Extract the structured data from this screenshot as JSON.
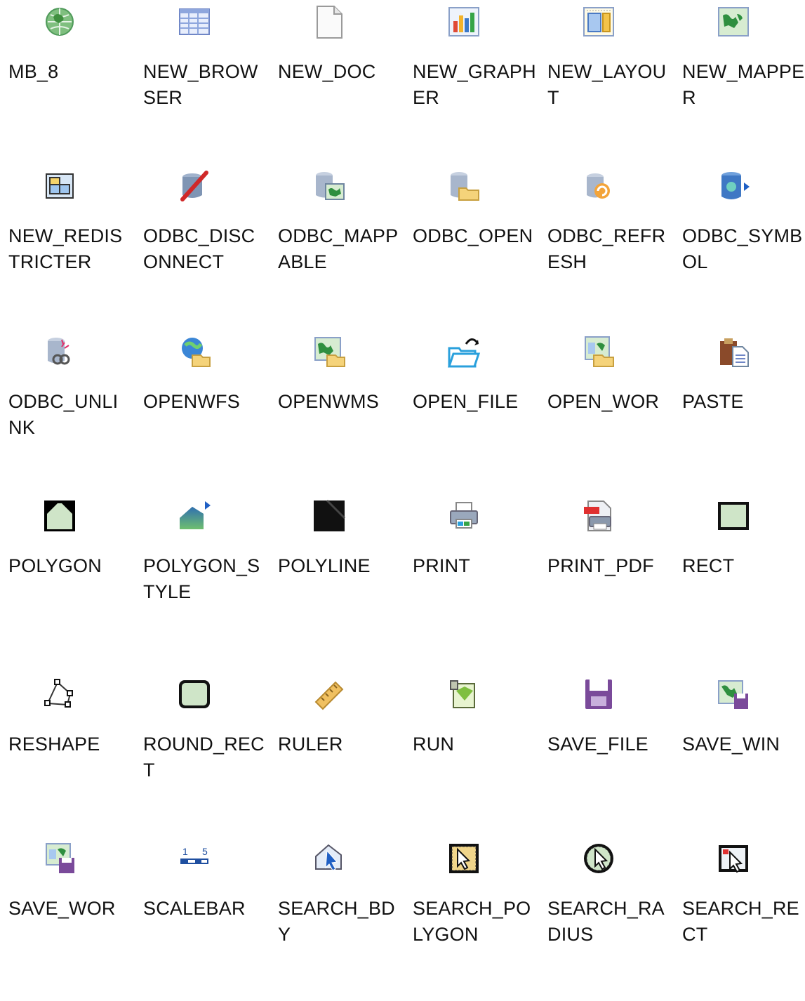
{
  "title": "",
  "icons": [
    {
      "label": "MB_8",
      "icon": "globe-icon"
    },
    {
      "label": "NEW_BROWSER",
      "icon": "table-browser-icon"
    },
    {
      "label": "NEW_DOC",
      "icon": "blank-document-icon"
    },
    {
      "label": "NEW_GRAPHER",
      "icon": "bar-graph-icon"
    },
    {
      "label": "NEW_LAYOUT",
      "icon": "layout-icon"
    },
    {
      "label": "NEW_MAPPER",
      "icon": "map-window-icon"
    },
    {
      "label": "NEW_REDISTRICTER",
      "icon": "redistricter-icon"
    },
    {
      "label": "ODBC_DISCONNECT",
      "icon": "database-disconnect-icon"
    },
    {
      "label": "ODBC_MAPPABLE",
      "icon": "database-map-icon"
    },
    {
      "label": "ODBC_OPEN",
      "icon": "database-open-folder-icon"
    },
    {
      "label": "ODBC_REFRESH",
      "icon": "database-refresh-icon"
    },
    {
      "label": "ODBC_SYMBOL",
      "icon": "database-symbol-icon"
    },
    {
      "label": "ODBC_UNLINK",
      "icon": "database-unlink-icon"
    },
    {
      "label": "OPENWFS",
      "icon": "globe-folder-icon"
    },
    {
      "label": "OPENWMS",
      "icon": "map-folder-icon"
    },
    {
      "label": "OPEN_FILE",
      "icon": "open-folder-arrow-icon"
    },
    {
      "label": "OPEN_WOR",
      "icon": "workspace-open-icon"
    },
    {
      "label": "PASTE",
      "icon": "clipboard-paste-icon"
    },
    {
      "label": "POLYGON",
      "icon": "polygon-icon"
    },
    {
      "label": "POLYGON_STYLE",
      "icon": "polygon-style-icon"
    },
    {
      "label": "POLYLINE",
      "icon": "polyline-icon"
    },
    {
      "label": "PRINT",
      "icon": "printer-icon"
    },
    {
      "label": "PRINT_PDF",
      "icon": "printer-pdf-icon"
    },
    {
      "label": "RECT",
      "icon": "rectangle-icon"
    },
    {
      "label": "RESHAPE",
      "icon": "reshape-nodes-icon"
    },
    {
      "label": "ROUND_RECT",
      "icon": "rounded-rectangle-icon"
    },
    {
      "label": "RULER",
      "icon": "ruler-icon"
    },
    {
      "label": "RUN",
      "icon": "run-script-icon"
    },
    {
      "label": "SAVE_FILE",
      "icon": "floppy-disk-icon"
    },
    {
      "label": "SAVE_WIN",
      "icon": "save-window-icon"
    },
    {
      "label": "SAVE_WOR",
      "icon": "save-workspace-icon"
    },
    {
      "label": "SCALEBAR",
      "icon": "scalebar-icon"
    },
    {
      "label": "SEARCH_BDY",
      "icon": "search-boundary-icon"
    },
    {
      "label": "SEARCH_POLYGON",
      "icon": "search-polygon-icon"
    },
    {
      "label": "SEARCH_RADIUS",
      "icon": "search-radius-icon"
    },
    {
      "label": "SEARCH_RECT",
      "icon": "search-rectangle-icon"
    }
  ],
  "scalebar_text": {
    "left": "1",
    "right": "5"
  }
}
